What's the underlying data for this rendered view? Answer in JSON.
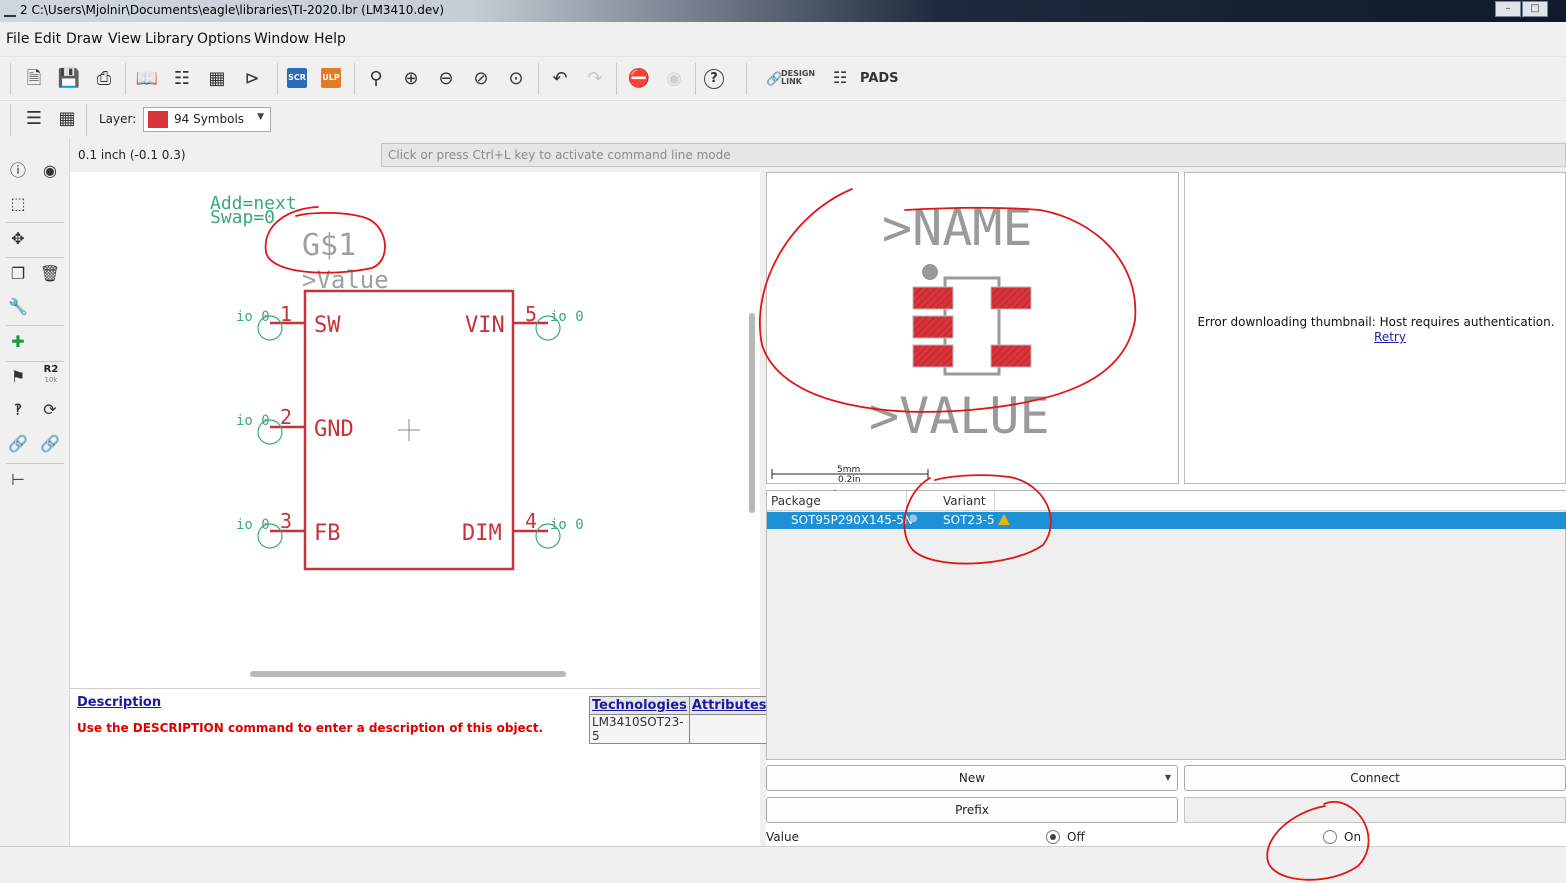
{
  "window": {
    "title": "2 C:\\Users\\Mjolnir\\Documents\\eagle\\libraries\\TI-2020.lbr (LM3410.dev)"
  },
  "menu": [
    "File",
    "Edit",
    "Draw",
    "View",
    "Library",
    "Options",
    "Window",
    "Help"
  ],
  "toolbar": {
    "scr_label": "SCR",
    "ulp_label": "ULP",
    "design_link_label": "DESIGN LINK",
    "pads_label": "PADS",
    "help_label": "?",
    "colors": {
      "scr": "#2d6cb8",
      "ulp": "#e27b22"
    }
  },
  "layerbar": {
    "label": "Layer:",
    "selected": "94 Symbols",
    "swatch_color": "#d8343a"
  },
  "leftbar": {
    "r2_label": "R2",
    "r2_sub": "10k"
  },
  "coord": "0.1 inch (-0.1 0.3)",
  "command": {
    "placeholder": "Click or press Ctrl+L key to activate command line mode"
  },
  "symbol": {
    "attrs": [
      "Add=next",
      "Swap=0"
    ],
    "name": "G$1",
    "value": ">Value",
    "pins": [
      {
        "num": "1",
        "name": "SW",
        "io": "io 0"
      },
      {
        "num": "2",
        "name": "GND",
        "io": "io 0"
      },
      {
        "num": "3",
        "name": "FB",
        "io": "io 0"
      },
      {
        "num": "5",
        "name": "VIN",
        "io": "io 0"
      },
      {
        "num": "4",
        "name": "DIM",
        "io": "io 0"
      }
    ],
    "colors": {
      "body": "#c8333a",
      "attr": "#3aaa7a",
      "text": "#a0a0a0"
    }
  },
  "description": {
    "title": "Description",
    "body": "Use the DESCRIPTION command to enter a description of this object."
  },
  "technologies": {
    "headers": [
      "Technologies",
      "Attributes"
    ],
    "rows": [
      [
        "LM3410SOT23-5",
        ""
      ]
    ]
  },
  "package_preview": {
    "name_label": ">NAME",
    "value_label": ">VALUE",
    "scale_mm": "5mm",
    "scale_in": "0.2in"
  },
  "thumbnail": {
    "error": "Error downloading thumbnail: Host requires authentication.",
    "retry": "Retry"
  },
  "package_table": {
    "headers": [
      "Package",
      "Variant"
    ],
    "rows": [
      {
        "package": "SOT95P290X145-5N",
        "variant": "SOT23-5",
        "warning": true
      }
    ]
  },
  "buttons": {
    "new": "New",
    "connect": "Connect",
    "prefix": "Prefix"
  },
  "value_option": {
    "label": "Value",
    "off": "Off",
    "on": "On",
    "selected": "Off"
  }
}
